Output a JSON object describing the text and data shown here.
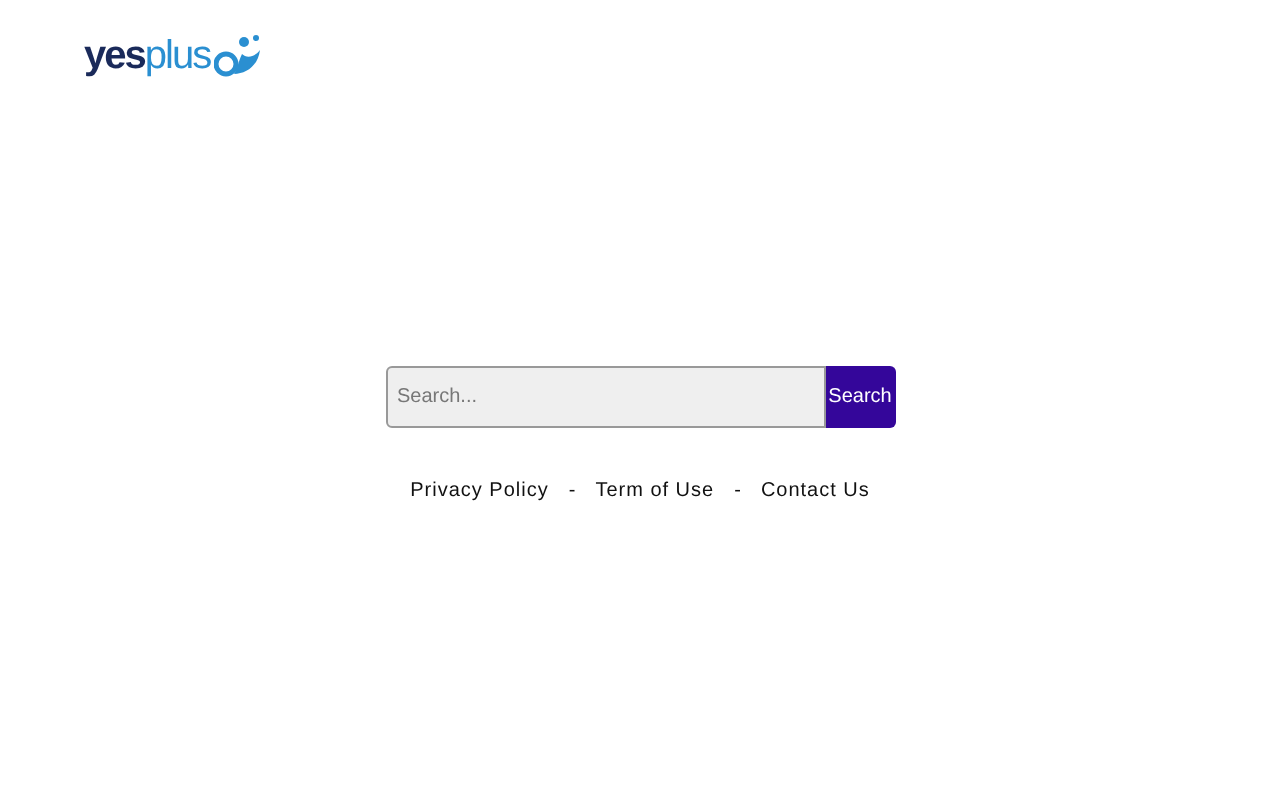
{
  "logo": {
    "text": "**yes**plus"
  },
  "search": {
    "placeholder": "Search...",
    "button": "Search"
  },
  "footer_links": [
    {
      "kind": "link",
      "label": "Privacy Policy"
    },
    {
      "kind": "separator",
      "label": "-"
    },
    {
      "kind": "link",
      "label": "Term of Use"
    },
    {
      "kind": "separator",
      "label": "-"
    },
    {
      "kind": "link",
      "label": "Contact Us"
    }
  ]
}
